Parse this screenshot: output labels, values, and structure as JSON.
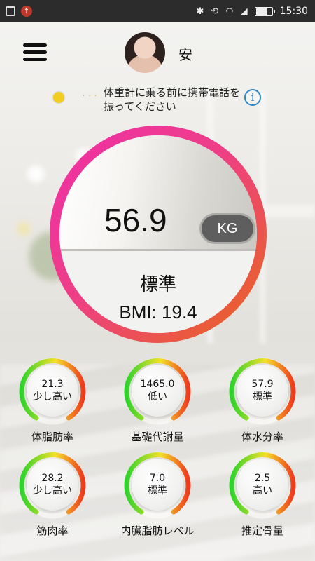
{
  "status_bar": {
    "time": "15:30",
    "battery_level": 0.85
  },
  "header": {
    "user_name": "安"
  },
  "tip": {
    "text": "体重計に乗る前に携帯電話を振ってください",
    "info_icon": "i"
  },
  "main": {
    "weight": "56.9",
    "unit": "KG",
    "status": "標準",
    "bmi": "BMI: 19.4"
  },
  "metrics": [
    {
      "value": "21.3",
      "level": "少し高い",
      "name": "体脂肪率"
    },
    {
      "value": "1465.0",
      "level": "低い",
      "name": "基礎代謝量"
    },
    {
      "value": "57.9",
      "level": "標準",
      "name": "体水分率"
    },
    {
      "value": "28.2",
      "level": "少し高い",
      "name": "筋肉率"
    },
    {
      "value": "7.0",
      "level": "標準",
      "name": "内臓脂肪レベル"
    },
    {
      "value": "2.5",
      "level": "高い",
      "name": "推定骨量"
    }
  ],
  "colors": {
    "accent_blue": "#2f86c8",
    "gauge_magenta": "#ee2fa7",
    "gauge_orange": "#e8661c",
    "gauge_green": "#2fd42a",
    "gauge_yellow": "#f4e02a",
    "gauge_red": "#ef3a1c"
  }
}
